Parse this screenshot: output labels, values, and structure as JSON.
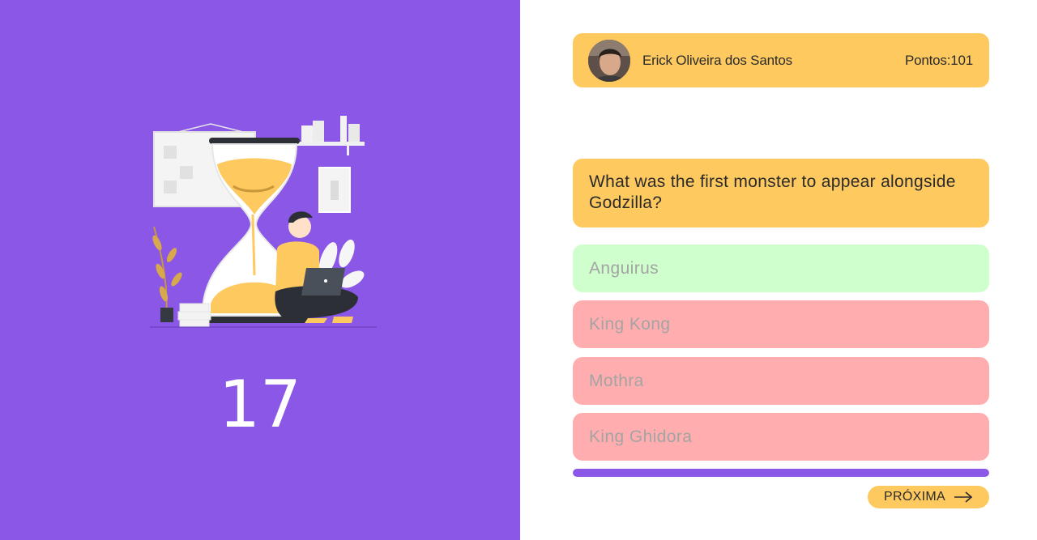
{
  "timer": {
    "seconds_left": "17"
  },
  "user": {
    "name": "Erick Oliveira dos Santos",
    "score_text": "Pontos:101"
  },
  "question": {
    "text": "What was the first monster to appear alongside Godzilla?"
  },
  "answers": [
    {
      "label": "Anguirus",
      "state": "correct"
    },
    {
      "label": "King Kong",
      "state": "wrong"
    },
    {
      "label": "Mothra",
      "state": "wrong"
    },
    {
      "label": "King Ghidora",
      "state": "wrong"
    }
  ],
  "progress": {
    "fraction": 1.0
  },
  "next": {
    "label": "PRÓXIMA",
    "icon": "arrow-right-icon"
  },
  "colors": {
    "purple": "#8a57e6",
    "yellow": "#fec95f",
    "correct_green": "#cfffcc",
    "wrong_red": "#ffadae"
  }
}
